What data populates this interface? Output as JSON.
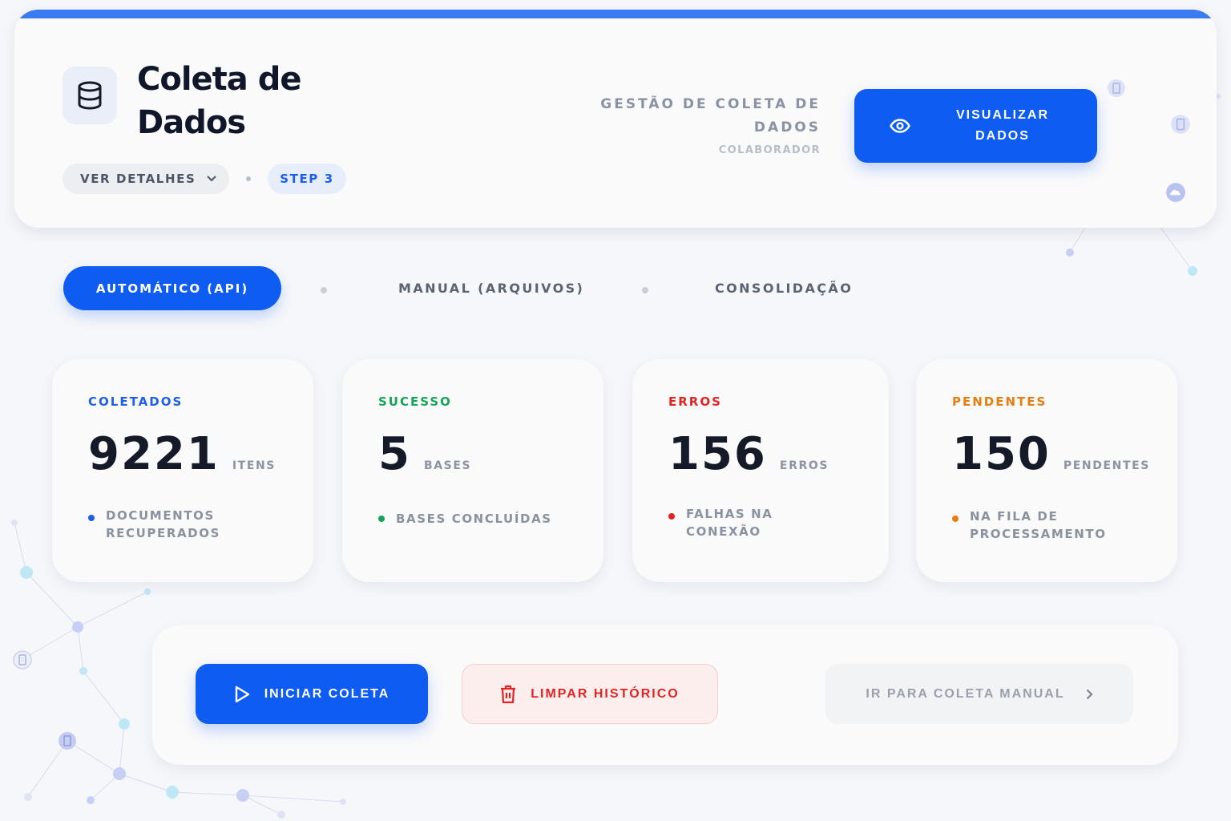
{
  "header": {
    "title": "Coleta de Dados",
    "app_icon": "database-icon",
    "details_label": "VER DETALHES",
    "step_label": "STEP 3",
    "subtitle": "GESTÃO DE COLETA DE DADOS",
    "role": "COLABORADOR",
    "view_button_label": "VISUALIZAR DADOS",
    "view_button_icon": "eye-icon"
  },
  "tabs": [
    {
      "label": "AUTOMÁTICO (API)",
      "active": true
    },
    {
      "label": "MANUAL (ARQUIVOS)",
      "active": false
    },
    {
      "label": "CONSOLIDAÇÃO",
      "active": false
    }
  ],
  "stats": [
    {
      "label": "COLETADOS",
      "value": "9221",
      "unit": "ITENS",
      "description": "DOCUMENTOS RECUPERADOS",
      "color": "#1f5fe6"
    },
    {
      "label": "SUCESSO",
      "value": "5",
      "unit": "BASES",
      "description": "BASES CONCLUÍDAS",
      "color": "#16a35a"
    },
    {
      "label": "ERROS",
      "value": "156",
      "unit": "ERROS",
      "description": "FALHAS NA CONEXÃO",
      "color": "#e12323"
    },
    {
      "label": "PENDENTES",
      "value": "150",
      "unit": "PENDENTES",
      "description": "NA FILA DE PROCESSAMENTO",
      "color": "#e57d10"
    }
  ],
  "actions": {
    "start_label": "INICIAR COLETA",
    "start_icon": "play-icon",
    "clear_label": "LIMPAR HISTÓRICO",
    "clear_icon": "trash-icon",
    "manual_label": "IR PARA COLETA MANUAL",
    "manual_icon": "chevron-right-icon"
  },
  "colors": {
    "primary": "#0f5cf2",
    "accent_bar": "#3b7bf0",
    "danger": "#e12323"
  }
}
